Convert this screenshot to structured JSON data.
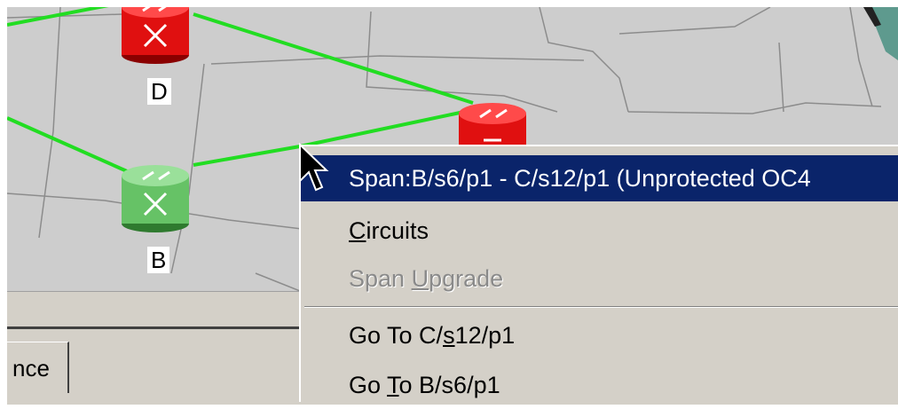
{
  "nodes": {
    "d_label": "D",
    "b_label": "B"
  },
  "tab": {
    "label": "nce"
  },
  "context_menu": {
    "header": "Span:B/s6/p1 - C/s12/p1 (Unprotected OC4",
    "items": [
      {
        "pre": "",
        "u": "C",
        "post": "ircuits",
        "enabled": true
      },
      {
        "pre": "Span ",
        "u": "U",
        "post": "pgrade",
        "enabled": false
      },
      {
        "pre": "Go To C/",
        "u": "s",
        "post": "12/p1",
        "enabled": true
      },
      {
        "pre": "Go ",
        "u": "T",
        "post": "o B/s6/p1",
        "enabled": true
      }
    ]
  },
  "colors": {
    "link": "#22dd22",
    "map_background": "#cdcdcd",
    "node_red": "#e01010",
    "node_green": "#66c266",
    "menu_highlight": "#0a246a"
  }
}
